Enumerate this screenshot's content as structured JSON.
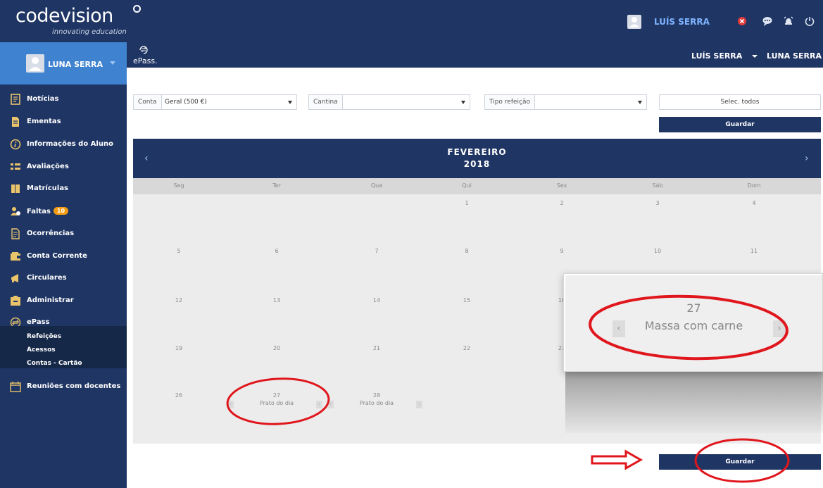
{
  "brand": {
    "name": "codevision",
    "tagline": "innovating education"
  },
  "topbar": {
    "user": "LUÍS SERRA",
    "icons": [
      "user-avatar-icon",
      "close-badge-icon",
      "chat-icon",
      "alarm-icon",
      "power-icon"
    ]
  },
  "sidebar": {
    "user": "LUNA SERRA",
    "items": [
      {
        "label": "Notícias",
        "icon": "news-icon"
      },
      {
        "label": "Ementas",
        "icon": "menu-icon"
      },
      {
        "label": "Informações do Aluno",
        "icon": "info-icon"
      },
      {
        "label": "Avaliações",
        "icon": "grades-icon"
      },
      {
        "label": "Matrículas",
        "icon": "enrollment-icon"
      },
      {
        "label": "Faltas",
        "icon": "absences-icon",
        "badge": "10"
      },
      {
        "label": "Ocorrências",
        "icon": "occurrences-icon"
      },
      {
        "label": "Conta Corrente",
        "icon": "wallet-icon"
      },
      {
        "label": "Circulares",
        "icon": "megaphone-icon"
      },
      {
        "label": "Administrar",
        "icon": "admin-icon"
      },
      {
        "label": "ePass",
        "icon": "epass-icon"
      },
      {
        "label": "Reuniões com docentes",
        "icon": "calendar-icon"
      }
    ],
    "subitems": [
      "Refeições",
      "Acessos",
      "Contas - Cartão"
    ]
  },
  "headbar": {
    "app_label": "ePass.",
    "user_menu": "LUÍS SERRA",
    "student": "LUNA SERRA"
  },
  "filters": {
    "conta": {
      "label": "Conta",
      "value": "Geral (500 €)"
    },
    "cantina": {
      "label": "Cantina",
      "value": ""
    },
    "tipo": {
      "label": "Tipo refeição",
      "value": ""
    },
    "select_all": "Selec. todos",
    "save": "Guardar"
  },
  "calendar": {
    "month": "FEVEREIRO",
    "year": "2018",
    "weekdays": [
      "Seg",
      "Ter",
      "Qua",
      "Qui",
      "Sex",
      "Sáb",
      "Dom"
    ],
    "weeks": [
      [
        "",
        "",
        "",
        "1",
        "2",
        "3",
        "4"
      ],
      [
        "5",
        "6",
        "7",
        "8",
        "9",
        "10",
        "11"
      ],
      [
        "12",
        "13",
        "14",
        "15",
        "16",
        "",
        ""
      ],
      [
        "19",
        "20",
        "21",
        "22",
        "23",
        "",
        ""
      ],
      [
        "26",
        "27",
        "28",
        "",
        "",
        "",
        ""
      ]
    ],
    "meals": [
      {
        "day": "27",
        "label": "Prato do dia"
      },
      {
        "day": "28",
        "label": "Prato do dia"
      }
    ]
  },
  "zoom": {
    "day": "27",
    "meal": "Massa com carne"
  },
  "bottom": {
    "save": "Guardar"
  },
  "colors": {
    "navy": "#1f3564",
    "accent": "#3f83d0",
    "annotation": "#e0161d"
  }
}
